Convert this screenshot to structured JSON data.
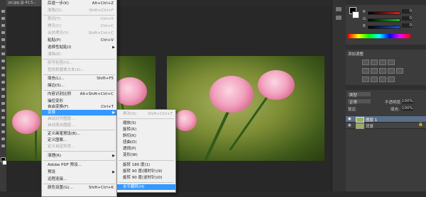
{
  "document_tab": {
    "label": "ps.jpg @ 41.5..."
  },
  "edit_menu": {
    "items": [
      {
        "label": "后退一步(K)",
        "shortcut": "Alt+Ctrl+Z",
        "disabled": false
      },
      {
        "label": "渐隐(D)...",
        "shortcut": "Shift+Ctrl+F",
        "disabled": true
      },
      {
        "label": "剪切(T)",
        "shortcut": "Ctrl+X",
        "disabled": true
      },
      {
        "label": "拷贝(C)",
        "shortcut": "Ctrl+C",
        "disabled": true
      },
      {
        "label": "合并拷贝(Y)",
        "shortcut": "Shift+Ctrl+C",
        "disabled": true
      },
      {
        "label": "粘贴(P)",
        "shortcut": "Ctrl+V",
        "disabled": false
      },
      {
        "label": "选择性粘贴(I)",
        "shortcut": "",
        "disabled": false,
        "submenu": true
      },
      {
        "label": "清除(E)",
        "shortcut": "",
        "disabled": true
      },
      {
        "label": "拼写检查(H)...",
        "shortcut": "",
        "disabled": true
      },
      {
        "label": "查找和替换文本(X)...",
        "shortcut": "",
        "disabled": true
      },
      {
        "label": "填充(L)...",
        "shortcut": "Shift+F5",
        "disabled": false
      },
      {
        "label": "描边(S)...",
        "shortcut": "",
        "disabled": false
      },
      {
        "label": "内容识别比例",
        "shortcut": "Alt+Shift+Ctrl+C",
        "disabled": false
      },
      {
        "label": "操控变形",
        "shortcut": "",
        "disabled": false
      },
      {
        "label": "自由变换(F)",
        "shortcut": "Ctrl+T",
        "disabled": false
      },
      {
        "label": "变换",
        "shortcut": "",
        "disabled": false,
        "highlighted": true,
        "submenu": true
      },
      {
        "label": "自动对齐图层...",
        "shortcut": "",
        "disabled": true
      },
      {
        "label": "自动混合图层...",
        "shortcut": "",
        "disabled": true
      },
      {
        "label": "定义画笔预设(B)...",
        "shortcut": "",
        "disabled": false
      },
      {
        "label": "定义图案...",
        "shortcut": "",
        "disabled": false
      },
      {
        "label": "定义自定形状...",
        "shortcut": "",
        "disabled": true
      },
      {
        "label": "清理(R)",
        "shortcut": "",
        "disabled": false,
        "submenu": true
      },
      {
        "label": "Adobe PDF 预设...",
        "shortcut": "",
        "disabled": false
      },
      {
        "label": "预设",
        "shortcut": "",
        "disabled": false,
        "submenu": true
      },
      {
        "label": "远程连接...",
        "shortcut": "",
        "disabled": false
      },
      {
        "label": "颜色设置(G)...",
        "shortcut": "Shift+Ctrl+K",
        "disabled": false
      }
    ]
  },
  "transform_submenu": {
    "items": [
      {
        "label": "再次(A)",
        "shortcut": "Shift+Ctrl+T",
        "disabled": true
      },
      {
        "label": "缩放(S)",
        "shortcut": ""
      },
      {
        "label": "旋转(R)",
        "shortcut": ""
      },
      {
        "label": "斜切(K)",
        "shortcut": ""
      },
      {
        "label": "扭曲(D)",
        "shortcut": ""
      },
      {
        "label": "透视(P)",
        "shortcut": ""
      },
      {
        "label": "变形(W)",
        "shortcut": ""
      },
      {
        "label": "旋转 180 度(1)",
        "shortcut": ""
      },
      {
        "label": "旋转 90 度(顺时针)(9)",
        "shortcut": ""
      },
      {
        "label": "旋转 90 度(逆时针)(0)",
        "shortcut": ""
      },
      {
        "label": "水平翻转(H)",
        "shortcut": "",
        "highlighted": true
      }
    ]
  },
  "color_panel": {
    "channels": [
      "R",
      "G",
      "B"
    ],
    "values": [
      "0",
      "0",
      "0"
    ],
    "slider_colors": [
      "#e02020",
      "#20c020",
      "#2050e0"
    ]
  },
  "adjustments_panel": {
    "title": "添加调整"
  },
  "layers_panel": {
    "kind_filter": "类型",
    "blend_mode": "正常",
    "opacity_label": "不透明度:",
    "opacity_value": "100%",
    "lock_label": "锁定:",
    "fill_label": "填充:",
    "fill_value": "100%",
    "layers": [
      {
        "name": "图层 1",
        "selected": true
      },
      {
        "name": "背景",
        "selected": false
      }
    ]
  }
}
